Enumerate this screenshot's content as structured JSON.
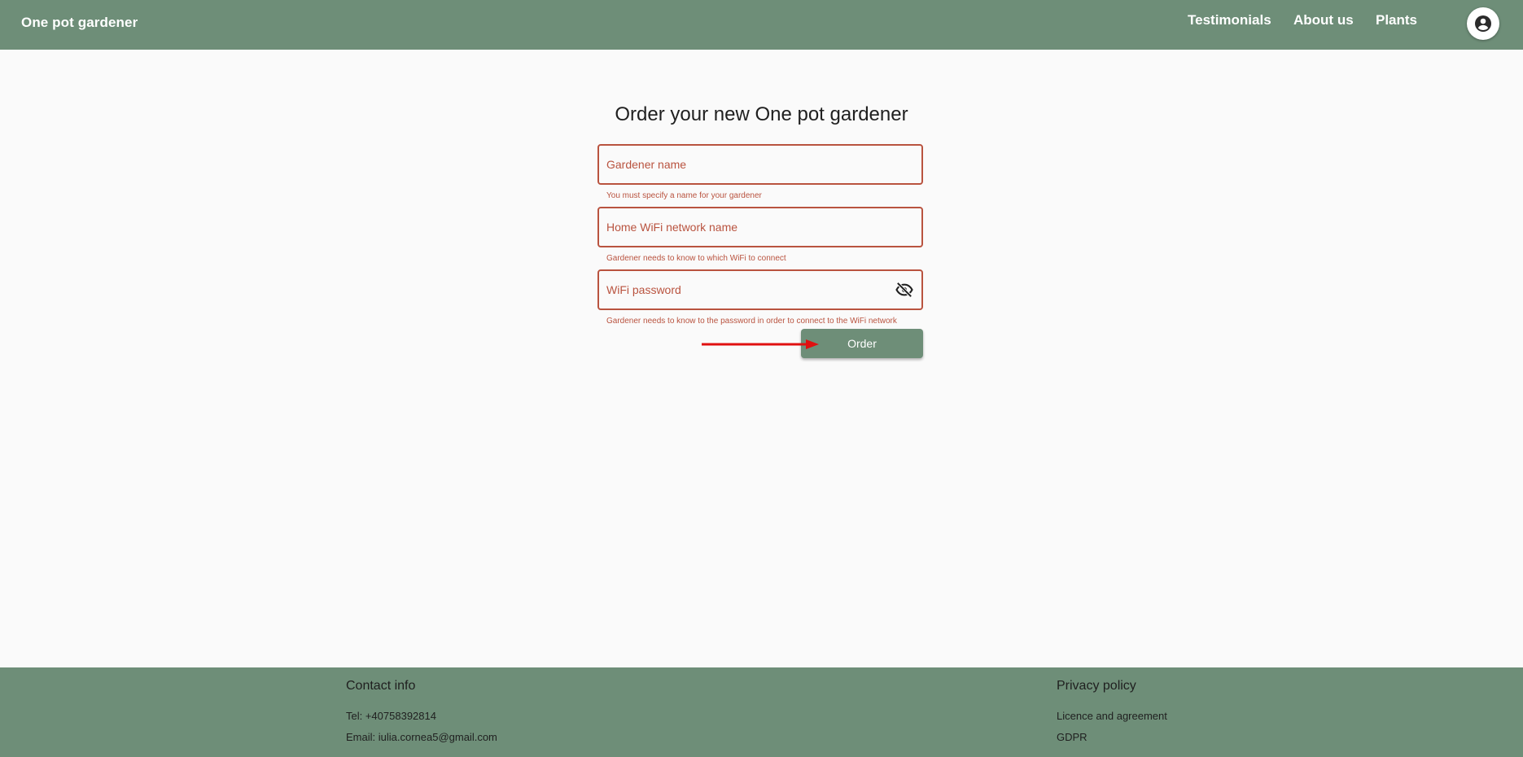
{
  "header": {
    "brand": "One pot gardener",
    "nav": {
      "testimonials": "Testimonials",
      "about": "About us",
      "plants": "Plants"
    },
    "account_icon": "account-circle-icon"
  },
  "form": {
    "title": "Order your new One pot gardener",
    "fields": {
      "gardener_name": {
        "placeholder": "Gardener name",
        "value": "",
        "error": "You must specify a name for your gardener"
      },
      "wifi_name": {
        "placeholder": "Home WiFi network name",
        "value": "",
        "error": "Gardener needs to know to which WiFi to connect"
      },
      "wifi_password": {
        "placeholder": "WiFi password",
        "value": "",
        "error": "Gardener needs to know to the password in order to connect to the WiFi network",
        "toggle_icon": "visibility-off-icon"
      }
    },
    "submit_label": "Order"
  },
  "footer": {
    "contact": {
      "heading": "Contact info",
      "tel": "Tel: +40758392814",
      "email": "Email: iulia.cornea5@gmail.com"
    },
    "privacy": {
      "heading": "Privacy policy",
      "licence": "Licence and agreement",
      "gdpr": "GDPR"
    }
  },
  "colors": {
    "primary": "#6e8e78",
    "error": "#b9533f",
    "background": "#fafafa",
    "annotation_arrow": "#e01010"
  }
}
